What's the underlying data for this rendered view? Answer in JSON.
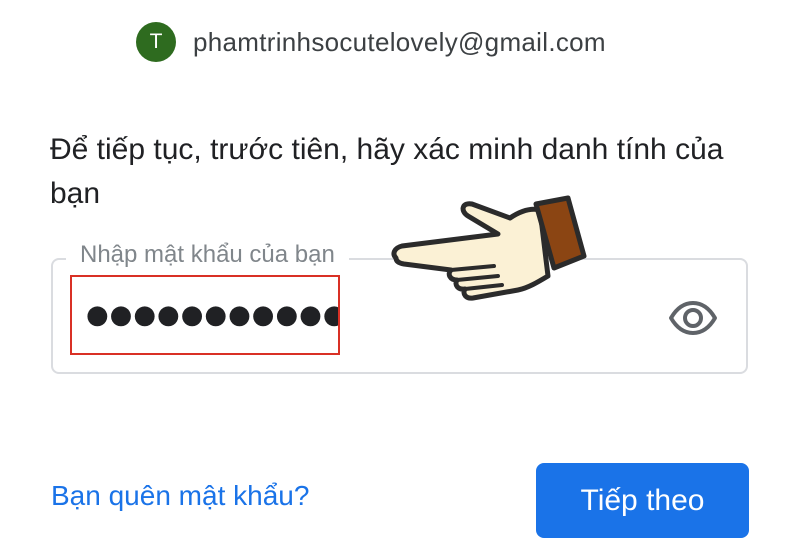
{
  "account": {
    "avatar_initial": "T",
    "email": "phamtrinhsocutelovely@gmail.com"
  },
  "prompt": "Để tiếp tục, trước tiên, hãy xác minh danh tính của bạn",
  "password_field": {
    "label": "Nhập mật khẩu của bạn",
    "masked_value": "●●●●●●●●●●●"
  },
  "icons": {
    "visibility_toggle": "eye-icon",
    "pointer": "pointing-hand-icon"
  },
  "actions": {
    "forgot_password_label": "Bạn quên mật khẩu?",
    "next_label": "Tiếp theo"
  },
  "colors": {
    "accent": "#1a73e8",
    "avatar": "#2e6b1f",
    "highlight": "#d93025"
  }
}
